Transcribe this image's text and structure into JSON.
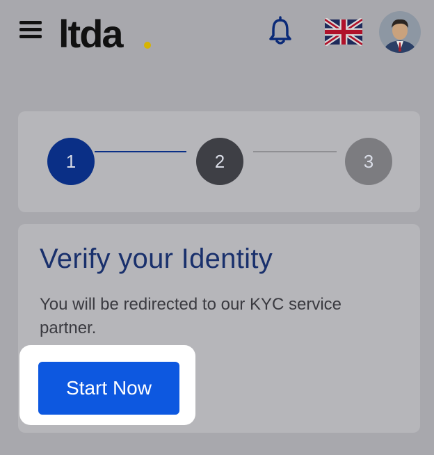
{
  "header": {
    "logo_text": "ltda",
    "menu_icon": "hamburger-menu-icon",
    "notification_icon": "bell-icon",
    "language_icon": "uk-flag-icon",
    "avatar_icon": "user-avatar"
  },
  "stepper": {
    "current_step": 1,
    "steps": [
      {
        "label": "1",
        "state": "active"
      },
      {
        "label": "2",
        "state": "pending"
      },
      {
        "label": "3",
        "state": "future"
      }
    ]
  },
  "verification": {
    "title": "Verify your Identity",
    "description": "You will be redirected to our KYC service partner.",
    "start_label": "Start Now"
  },
  "colors": {
    "primary": "#0d58e0",
    "active_step": "#0a2f86",
    "title": "#19306c",
    "logo_dot": "#d7b400"
  }
}
